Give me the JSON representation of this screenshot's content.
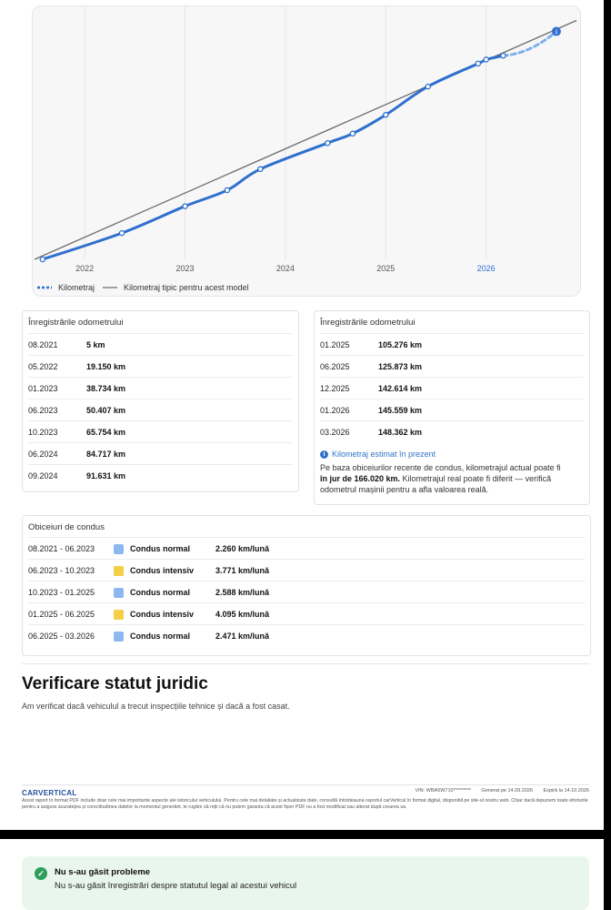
{
  "chart_data": {
    "type": "line",
    "x_tick_labels": [
      "2022",
      "2023",
      "2024",
      "2025",
      "2026"
    ],
    "highlighted_tick": "2026",
    "series": [
      {
        "name": "Kilometraj",
        "color": "#2f6fce",
        "points": [
          {
            "date": "2021.58",
            "km": 5
          },
          {
            "date": "2022.37",
            "km": 19150
          },
          {
            "date": "2023.00",
            "km": 38734
          },
          {
            "date": "2023.42",
            "km": 50407
          },
          {
            "date": "2023.75",
            "km": 65754
          },
          {
            "date": "2024.42",
            "km": 84717
          },
          {
            "date": "2024.67",
            "km": 91631
          },
          {
            "date": "2025.00",
            "km": 105276
          },
          {
            "date": "2025.42",
            "km": 125873
          },
          {
            "date": "2025.92",
            "km": 142614
          },
          {
            "date": "2026.00",
            "km": 145559
          },
          {
            "date": "2026.17",
            "km": 148362
          }
        ],
        "estimate": {
          "date": "2026.70",
          "km": 166020
        }
      },
      {
        "name": "Kilometraj tipic pentru acest model",
        "color": "#6e6e6e",
        "points": [
          {
            "date": "2021.50",
            "km": 0
          },
          {
            "date": "2026.90",
            "km": 174000
          }
        ]
      }
    ],
    "xlim": [
      2021.5,
      2026.9
    ],
    "ylim": [
      0,
      175000
    ],
    "grid": "vertical",
    "legend_position": "bottom-left"
  },
  "legend": {
    "mileage": "Kilometraj",
    "typical": "Kilometraj tipic pentru acest model"
  },
  "odometer_left": {
    "title": "Înregistrările odometrului",
    "rows": [
      {
        "date": "08.2021",
        "km": "5 km"
      },
      {
        "date": "05.2022",
        "km": "19.150 km"
      },
      {
        "date": "01.2023",
        "km": "38.734 km"
      },
      {
        "date": "06.2023",
        "km": "50.407 km"
      },
      {
        "date": "10.2023",
        "km": "65.754 km"
      },
      {
        "date": "06.2024",
        "km": "84.717 km"
      },
      {
        "date": "09.2024",
        "km": "91.631 km"
      }
    ]
  },
  "odometer_right": {
    "title": "Înregistrările odometrului",
    "rows": [
      {
        "date": "01.2025",
        "km": "105.276 km"
      },
      {
        "date": "06.2025",
        "km": "125.873 km"
      },
      {
        "date": "12.2025",
        "km": "142.614 km"
      },
      {
        "date": "01.2026",
        "km": "145.559 km"
      },
      {
        "date": "03.2026",
        "km": "148.362 km"
      }
    ],
    "estimate_label": "Kilometraj estimat în prezent",
    "estimate_pre": "Pe baza obiceiurilor recente de condus, kilometrajul actual poate fi ",
    "estimate_bold": "în jur de 166.020 km.",
    "estimate_post": " Kilometrajul real poate fi diferit — verifică odometrul mașinii pentru a afla valoarea reală."
  },
  "habits": {
    "title": "Obiceiuri de condus",
    "rows": [
      {
        "period": "08.2021 - 06.2023",
        "type": "Condus normal",
        "rate": "2.260 km/lună",
        "color": "#8cb8ef"
      },
      {
        "period": "06.2023 - 10.2023",
        "type": "Condus intensiv",
        "rate": "3.771 km/lună",
        "color": "#f5cf45"
      },
      {
        "period": "10.2023 - 01.2025",
        "type": "Condus normal",
        "rate": "2.588 km/lună",
        "color": "#8cb8ef"
      },
      {
        "period": "01.2025 - 06.2025",
        "type": "Condus intensiv",
        "rate": "4.095 km/lună",
        "color": "#f5cf45"
      },
      {
        "period": "06.2025 - 03.2026",
        "type": "Condus normal",
        "rate": "2.471 km/lună",
        "color": "#8cb8ef"
      }
    ]
  },
  "legal": {
    "title": "Verificare statut juridic",
    "subtitle": "Am verificat dacă vehiculul a trecut inspecțiile tehnice și dacă a fost casat."
  },
  "footer": {
    "brand": "CARVERTICAL",
    "vin": "VIN: WBA5W710*********",
    "generated": "Generat pe 14.09.2026",
    "expires": "Expiră la 14.10.2026",
    "disclaimer": "Acest raport în format PDF include doar cele mai importante aspecte ale istoricului vehiculului. Pentru cele mai detaliate și actualizate date, consultă întotdeauna raportul carVertical în format digital, disponibil pe site-ul nostru web. Chiar dacă depunem toate eforturile pentru a asigura acuratețea și corectitudinea datelor la momentul generării, te rugăm să reții că nu putem garanta că acest fișier PDF nu a fost modificat sau alterat după crearea sa."
  },
  "status_box": {
    "title": "Nu s-au găsit probleme",
    "text": "Nu s-au găsit înregistrări despre statutul legal al acestui vehicul"
  }
}
